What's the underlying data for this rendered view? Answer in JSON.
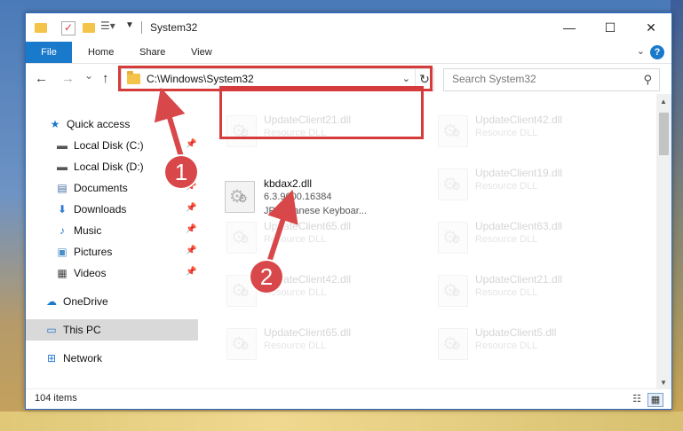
{
  "window": {
    "title": "System32",
    "controls": {
      "minimize": "—",
      "maximize": "☐",
      "close": "✕"
    }
  },
  "ribbon": {
    "file": "File",
    "tabs": [
      "Home",
      "Share",
      "View"
    ],
    "help": "?"
  },
  "nav": {
    "back": "←",
    "forward": "→",
    "recent": "⌄",
    "up": "↑",
    "address": "C:\\Windows\\System32",
    "search_placeholder": "Search System32"
  },
  "sidebar": {
    "items": [
      {
        "label": "Quick access",
        "icon": "star-icon",
        "glyph": "★",
        "color": "#1979ca",
        "pinned": false
      },
      {
        "label": "Local Disk (C:)",
        "icon": "drive-icon",
        "glyph": "▬",
        "color": "#555555",
        "pinned": true
      },
      {
        "label": "Local Disk (D:)",
        "icon": "drive-icon",
        "glyph": "▬",
        "color": "#555555",
        "pinned": true
      },
      {
        "label": "Documents",
        "icon": "documents-icon",
        "glyph": "▤",
        "color": "#4a6fa5",
        "pinned": true
      },
      {
        "label": "Downloads",
        "icon": "download-icon",
        "glyph": "⬇",
        "color": "#2b7ad1",
        "pinned": true
      },
      {
        "label": "Music",
        "icon": "music-icon",
        "glyph": "♪",
        "color": "#2b7ad1",
        "pinned": true
      },
      {
        "label": "Pictures",
        "icon": "pictures-icon",
        "glyph": "▣",
        "color": "#4a8fc8",
        "pinned": true
      },
      {
        "label": "Videos",
        "icon": "videos-icon",
        "glyph": "▦",
        "color": "#444444",
        "pinned": true
      },
      {
        "label": "OneDrive",
        "icon": "cloud-icon",
        "glyph": "☁",
        "color": "#1979ca",
        "pinned": false
      },
      {
        "label": "This PC",
        "icon": "computer-icon",
        "glyph": "▭",
        "color": "#2b7ad1",
        "pinned": false
      },
      {
        "label": "Network",
        "icon": "network-icon",
        "glyph": "⊞",
        "color": "#2b7ad1",
        "pinned": false
      }
    ]
  },
  "files": [
    {
      "name": "UpdateClient21.dll",
      "type": "Resource DLL",
      "faded": true
    },
    {
      "name": "UpdateClient42.dll",
      "type": "Resource DLL",
      "faded": true
    },
    {
      "name": "kbdax2.dll",
      "version": "6.3.9600.16384",
      "description": "JP Japanese Keyboar...",
      "faded": false
    },
    {
      "name": "UpdateClient19.dll",
      "type": "Resource DLL",
      "faded": true
    },
    {
      "name": "UpdateClient65.dll",
      "type": "Resource DLL",
      "faded": true
    },
    {
      "name": "UpdateClient63.dll",
      "type": "Resource DLL",
      "faded": true
    },
    {
      "name": "UpdateClient42.dll",
      "type": "Resource DLL",
      "faded": true
    },
    {
      "name": "UpdateClient21.dll",
      "type": "Resource DLL",
      "faded": true
    },
    {
      "name": "UpdateClient65.dll",
      "type": "Resource DLL",
      "faded": true
    },
    {
      "name": "UpdateClient5.dll",
      "type": "Resource DLL",
      "faded": true
    }
  ],
  "status": {
    "item_count": "104 items"
  },
  "annotations": {
    "step1": "1",
    "step2": "2",
    "accent": "#d63b3b"
  }
}
